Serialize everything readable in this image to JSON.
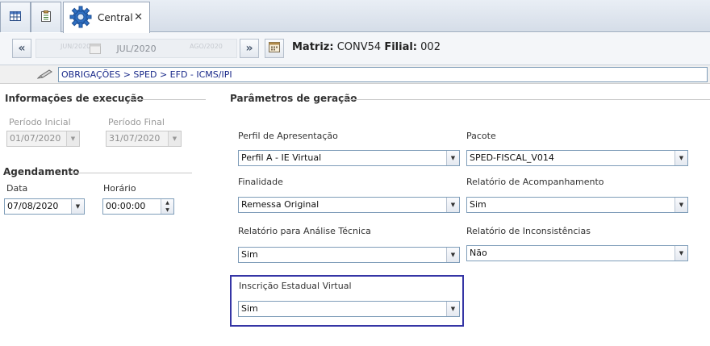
{
  "tabs": {
    "central_label": "Central",
    "close_glyph": "✕"
  },
  "toolbar": {
    "prev_glyph": "«",
    "next_glyph": "»",
    "period": "JUL/2020",
    "period_prev_ghost": "JUN/2020",
    "period_next_ghost": "AGO/2020",
    "matriz_label": "Matriz:",
    "matriz_value": "CONV54",
    "filial_label": "Filial:",
    "filial_value": "002"
  },
  "breadcrumb": {
    "path": "OBRIGAÇÕES > SPED > EFD - ICMS/IPI"
  },
  "execucao": {
    "title": "Informações de execução",
    "periodo_inicial_label": "Período  Inicial",
    "periodo_inicial_value": "01/07/2020",
    "periodo_final_label": "Período Final",
    "periodo_final_value": "31/07/2020"
  },
  "agendamento": {
    "title": "Agendamento",
    "data_label": "Data",
    "data_value": "07/08/2020",
    "horario_label": "Horário",
    "horario_value": "00:00:00"
  },
  "parametros": {
    "title": "Parâmetros de geração",
    "perfil_label": "Perfil de Apresentação",
    "perfil_value": "Perfil A - IE Virtual",
    "pacote_label": "Pacote",
    "pacote_value": "SPED-FISCAL_V014",
    "finalidade_label": "Finalidade",
    "finalidade_value": "Remessa Original",
    "rel_acomp_label": "Relatório de Acompanhamento",
    "rel_acomp_value": "Sim",
    "rel_analise_label": "Relatório para Análise Técnica",
    "rel_analise_value": "Sim",
    "rel_incons_label": "Relatório de Inconsistências",
    "rel_incons_value": "Não",
    "ie_virtual_label": "Inscrição Estadual Virtual",
    "ie_virtual_value": "Sim"
  },
  "icons": {
    "tab1": "grid-table-icon",
    "tab2": "clipboard-checklist-icon",
    "central": "gear-icon",
    "period": "calendar-icon",
    "breadcrumb": "pen-icon"
  },
  "colors": {
    "highlight": "#3535a5",
    "breadcrumb_text": "#1a2a8a",
    "gear": "#2f6fc2"
  }
}
